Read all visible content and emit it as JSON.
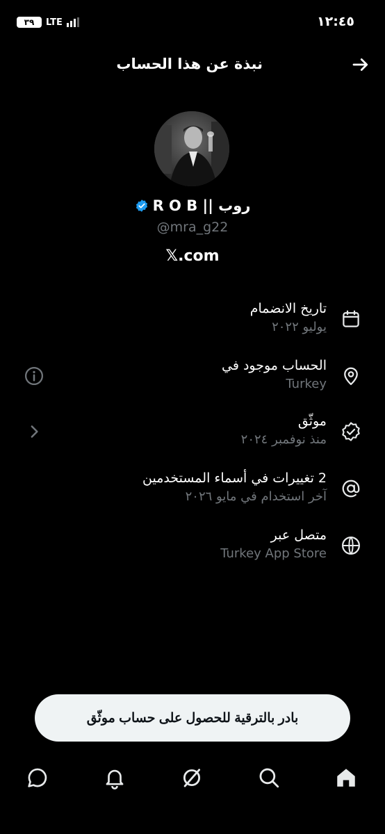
{
  "status_bar": {
    "time": "١٢:٤٥",
    "battery": "٣٩",
    "network": "LTE"
  },
  "header": {
    "title": "نبذة عن هذا الحساب",
    "back_icon": "arrow-right-icon"
  },
  "profile": {
    "display_name": "روب || R O B",
    "handle": "@mra_g22",
    "site": "𝕏.com",
    "verified_color": "#1d9bf0"
  },
  "rows": [
    {
      "title": "تاريخ الانضمام",
      "subtitle": "يوليو ٢٠٢٢",
      "icon": "calendar-icon"
    },
    {
      "title": "الحساب موجود في",
      "subtitle": "Turkey",
      "icon": "location-pin-icon",
      "aux_icon": "info-icon"
    },
    {
      "title": "موثّق",
      "subtitle": "منذ نوفمبر ٢٠٢٤",
      "icon": "verified-check-icon",
      "aux_icon": "chevron-left-icon"
    },
    {
      "title": "2 تغييرات في أسماء المستخدمين",
      "subtitle": "آخر استخدام في مايو ٢٠٢٦",
      "icon": "at-sign-icon"
    },
    {
      "title": "متصل عبر",
      "subtitle": "Turkey App Store",
      "icon": "globe-icon"
    }
  ],
  "upgrade_button": "بادر بالترقية للحصول على حساب موثّق",
  "nav": [
    "home-icon",
    "search-icon",
    "grok-icon",
    "notifications-icon",
    "messages-icon"
  ]
}
